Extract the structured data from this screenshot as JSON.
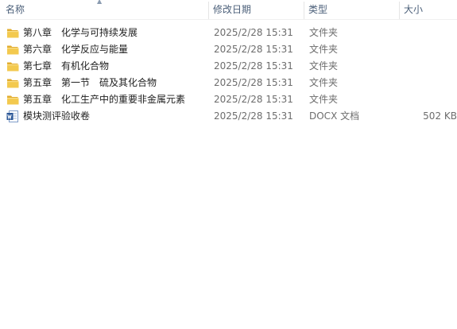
{
  "columns": {
    "name": "名称",
    "date": "修改日期",
    "type": "类型",
    "size": "大小"
  },
  "files": [
    {
      "name": "第八章　化学与可持续发展",
      "date": "2025/2/28 15:31",
      "type": "文件夹",
      "size": "",
      "icon": "folder-icon"
    },
    {
      "name": "第六章　化学反应与能量",
      "date": "2025/2/28 15:31",
      "type": "文件夹",
      "size": "",
      "icon": "folder-icon"
    },
    {
      "name": "第七章　有机化合物",
      "date": "2025/2/28 15:31",
      "type": "文件夹",
      "size": "",
      "icon": "folder-icon"
    },
    {
      "name": "第五章　第一节　硫及其化合物",
      "date": "2025/2/28 15:31",
      "type": "文件夹",
      "size": "",
      "icon": "folder-icon"
    },
    {
      "name": "第五章　化工生产中的重要非金属元素",
      "date": "2025/2/28 15:31",
      "type": "文件夹",
      "size": "",
      "icon": "folder-icon"
    },
    {
      "name": "模块测评验收卷",
      "date": "2025/2/28 15:31",
      "type": "DOCX 文档",
      "size": "502 KB",
      "icon": "word-document-icon"
    }
  ],
  "colors": {
    "header_text": "#4c607a",
    "folder_yellow": "#f3c94e",
    "word_blue": "#2b5797"
  }
}
